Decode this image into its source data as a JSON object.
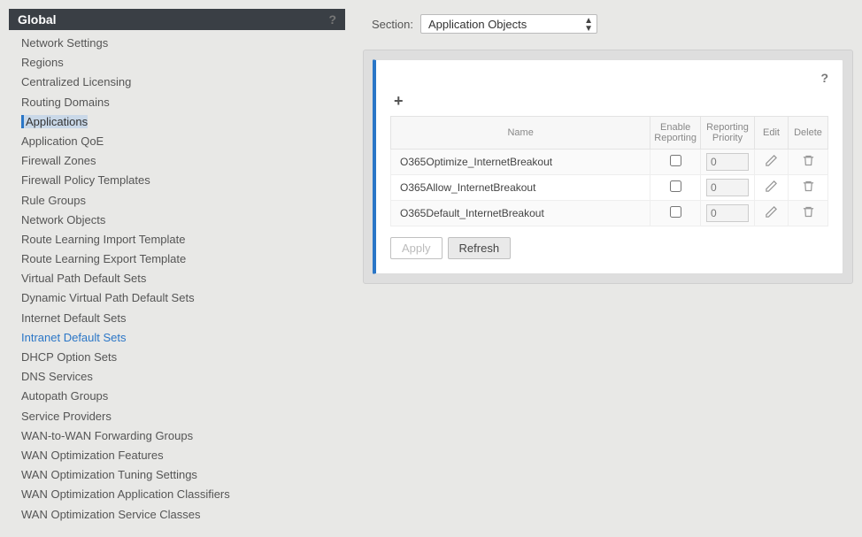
{
  "sidebar": {
    "header": "Global",
    "items": [
      {
        "label": "Network Settings"
      },
      {
        "label": "Regions"
      },
      {
        "label": "Centralized Licensing"
      },
      {
        "label": "Routing Domains"
      },
      {
        "label": "Applications",
        "selected": true
      },
      {
        "label": "Application QoE"
      },
      {
        "label": "Firewall Zones"
      },
      {
        "label": "Firewall Policy Templates"
      },
      {
        "label": "Rule Groups"
      },
      {
        "label": "Network Objects"
      },
      {
        "label": "Route Learning Import Template"
      },
      {
        "label": "Route Learning Export Template"
      },
      {
        "label": "Virtual Path Default Sets"
      },
      {
        "label": "Dynamic Virtual Path Default Sets"
      },
      {
        "label": "Internet Default Sets"
      },
      {
        "label": "Intranet Default Sets",
        "blue": true
      },
      {
        "label": "DHCP Option Sets"
      },
      {
        "label": "DNS Services"
      },
      {
        "label": "Autopath Groups"
      },
      {
        "label": "Service Providers"
      },
      {
        "label": "WAN-to-WAN Forwarding Groups"
      },
      {
        "label": "WAN Optimization Features"
      },
      {
        "label": "WAN Optimization Tuning Settings"
      },
      {
        "label": "WAN Optimization Application Classifiers"
      },
      {
        "label": "WAN Optimization Service Classes"
      }
    ]
  },
  "section": {
    "label": "Section:",
    "selected": "Application Objects"
  },
  "table": {
    "headers": {
      "name": "Name",
      "enable": "Enable Reporting",
      "prio": "Reporting Priority",
      "edit": "Edit",
      "del": "Delete"
    },
    "rows": [
      {
        "name": "O365Optimize_InternetBreakout",
        "enable": false,
        "prio": "0"
      },
      {
        "name": "O365Allow_InternetBreakout",
        "enable": false,
        "prio": "0"
      },
      {
        "name": "O365Default_InternetBreakout",
        "enable": false,
        "prio": "0"
      }
    ]
  },
  "buttons": {
    "apply": "Apply",
    "refresh": "Refresh"
  },
  "icons": {
    "help": "?",
    "plus": "+"
  }
}
